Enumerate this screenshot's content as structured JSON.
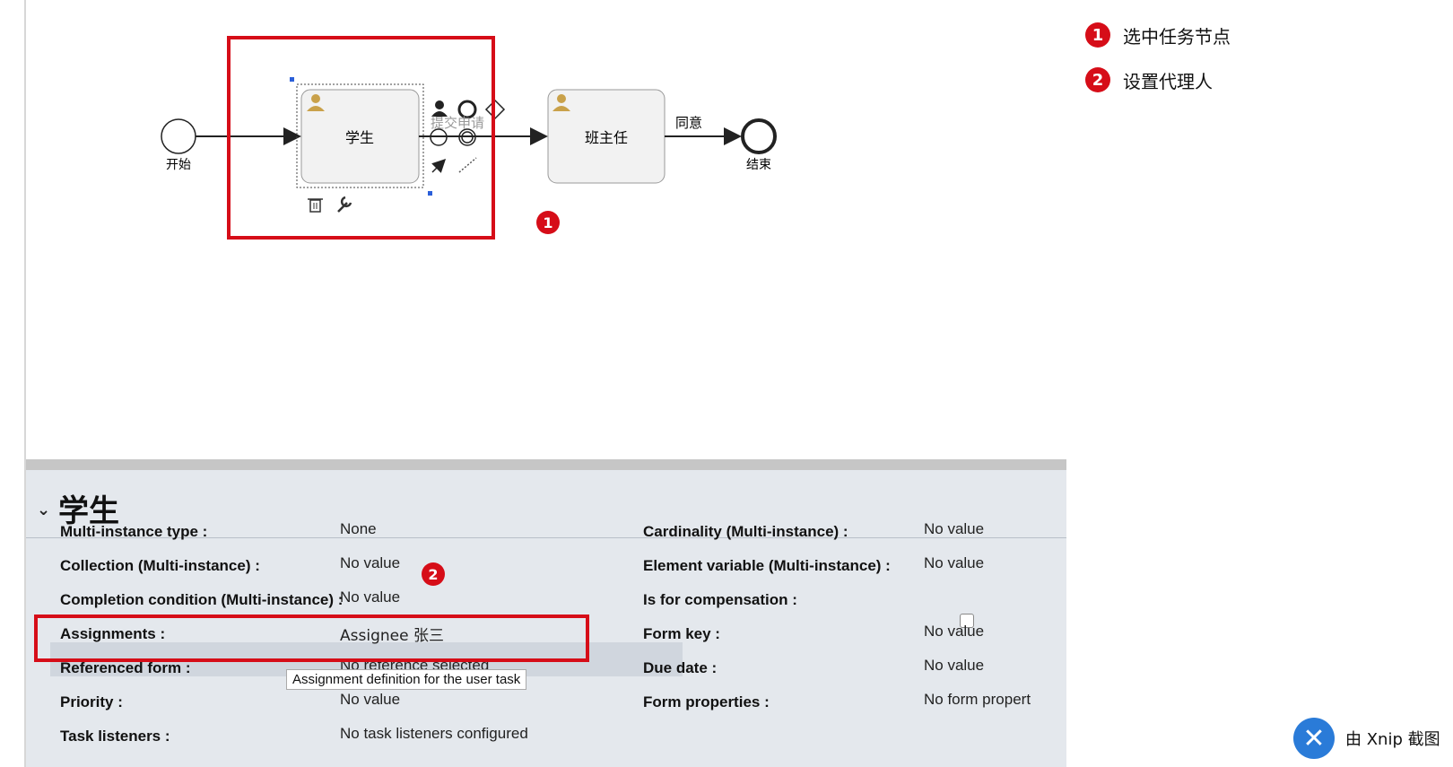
{
  "diagram": {
    "start_label": "开始",
    "task1_label": "学生",
    "task2_label": "班主任",
    "flow1_label": "提交申请",
    "flow2_label": "同意",
    "end_label": "结束",
    "marker1": "1",
    "marker2": "2"
  },
  "legend": {
    "items": [
      {
        "num": "1",
        "text": "选中任务节点"
      },
      {
        "num": "2",
        "text": "设置代理人"
      }
    ]
  },
  "panel": {
    "title": "学生",
    "left_props": [
      {
        "label": "Multi-instance type :",
        "value": "None"
      },
      {
        "label": "Collection (Multi-instance) :",
        "value": "No value"
      },
      {
        "label": "Completion condition (Multi-instance) :",
        "value": "No value"
      },
      {
        "label": "Assignments :",
        "value": "Assignee 张三"
      },
      {
        "label": "Referenced form :",
        "value": "No reference selected"
      },
      {
        "label": "Priority :",
        "value": "No value"
      },
      {
        "label": "Task listeners :",
        "value": "No task listeners configured"
      }
    ],
    "right_props": [
      {
        "label": "Cardinality (Multi-instance) :",
        "value": "No value"
      },
      {
        "label": "Element variable (Multi-instance) :",
        "value": "No value"
      },
      {
        "label": "Is for compensation :",
        "value": ""
      },
      {
        "label": "Form key :",
        "value": "No value"
      },
      {
        "label": "Due date :",
        "value": "No value"
      },
      {
        "label": "Form properties :",
        "value": "No form propert"
      }
    ],
    "tooltip": "Assignment definition for the user task"
  },
  "watermark": "由 Xnip 截图",
  "colors": {
    "accent_red": "#d60d18",
    "panel_bg": "#e4e8ed",
    "user_icon": "#c9a14a"
  }
}
